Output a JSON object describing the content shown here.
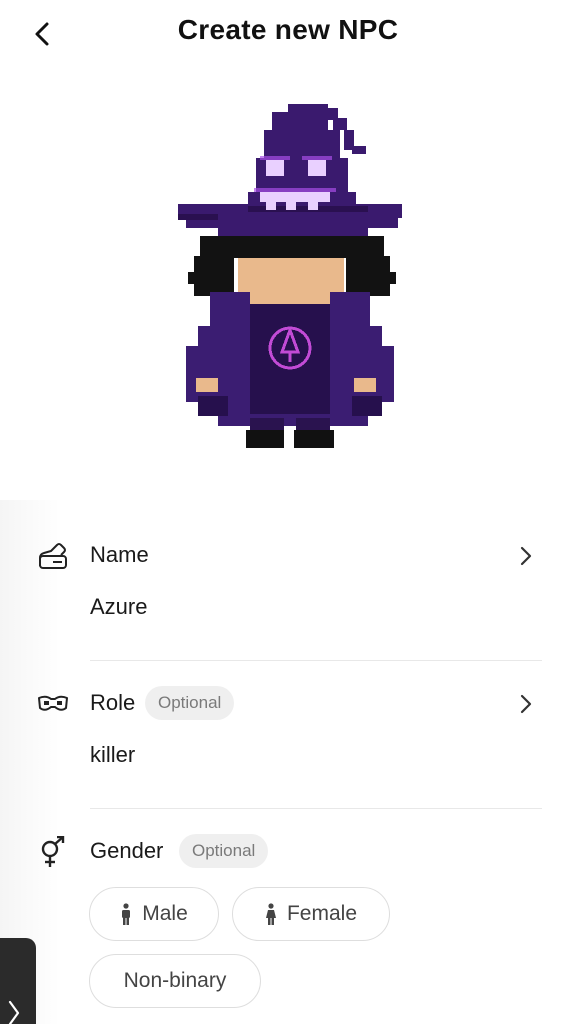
{
  "header": {
    "title": "Create new NPC"
  },
  "fields": {
    "name": {
      "label": "Name",
      "value": "Azure"
    },
    "role": {
      "label": "Role",
      "optional": "Optional",
      "value": "killer"
    },
    "gender": {
      "label": "Gender",
      "optional": "Optional",
      "options": [
        "Male",
        "Female",
        "Non-binary"
      ]
    }
  },
  "icons": {
    "back": "back-arrow-icon",
    "name": "name-tag-icon",
    "role": "mask-icon",
    "gender": "gender-symbol-icon",
    "chevron": "chevron-right-icon"
  },
  "colors": {
    "hat": "#3a1a6e",
    "robe": "#3b1d72",
    "glow": "#b45cff",
    "hair": "#111111",
    "skin": "#e9b98c"
  }
}
